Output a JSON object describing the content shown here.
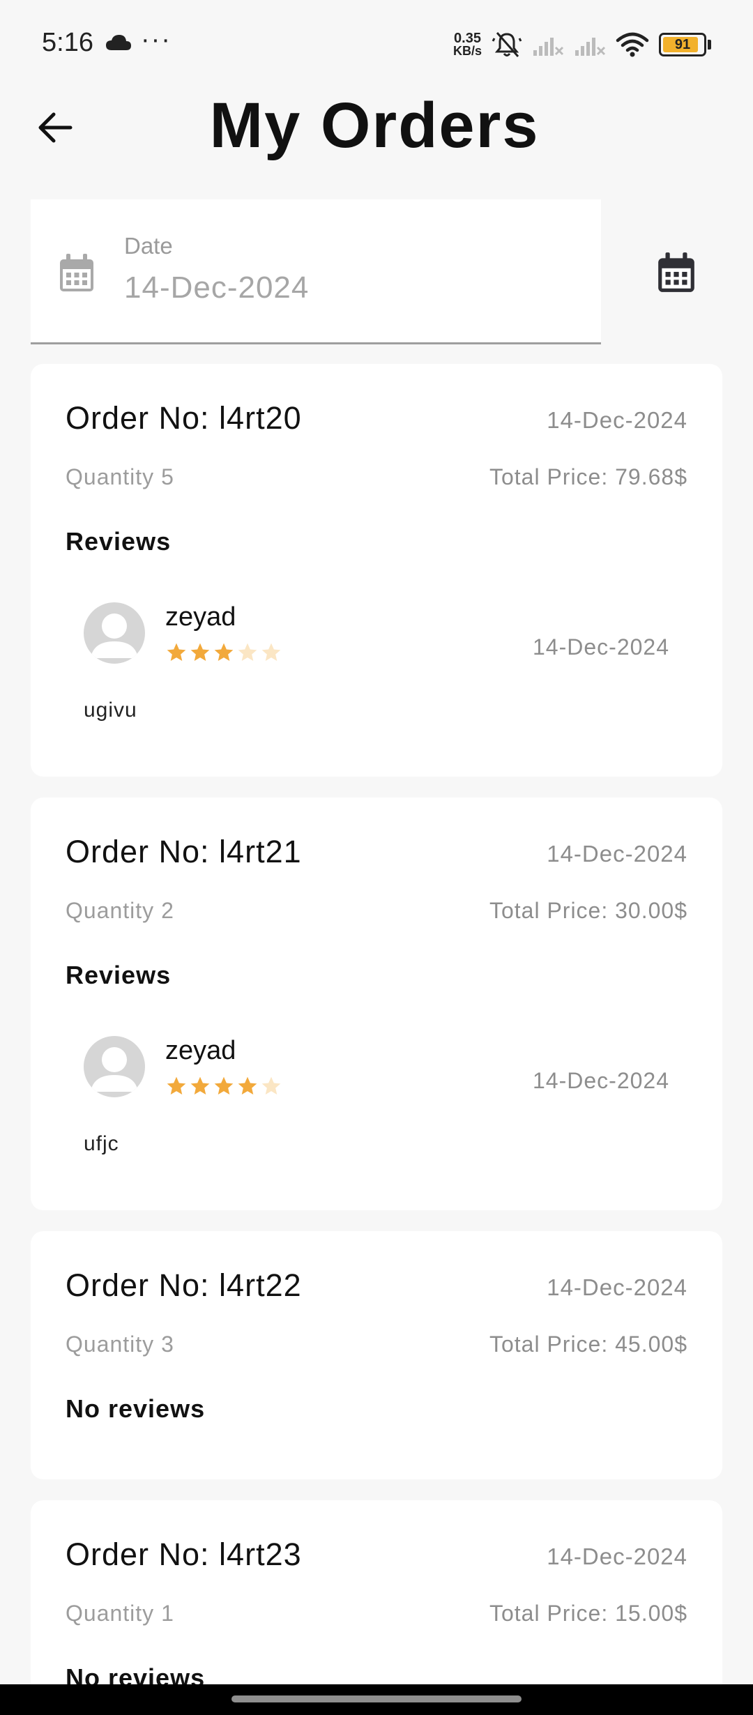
{
  "status_bar": {
    "time": "5:16",
    "dots": "···",
    "net_speed_value": "0.35",
    "net_speed_unit": "KB/s",
    "battery_level": 91,
    "battery_color": "#f2b12c"
  },
  "header": {
    "title": "My Orders"
  },
  "date_filter": {
    "label": "Date",
    "value": "14-Dec-2024"
  },
  "orders": [
    {
      "order_no": "Order No: l4rt20",
      "date": "14-Dec-2024",
      "quantity": "Quantity 5",
      "total_price": "Total Price: 79.68$",
      "reviews_heading": "Reviews",
      "review": {
        "name": "zeyad",
        "rating": 3,
        "date": "14-Dec-2024",
        "text": "ugivu"
      }
    },
    {
      "order_no": "Order No: l4rt21",
      "date": "14-Dec-2024",
      "quantity": "Quantity 2",
      "total_price": "Total Price: 30.00$",
      "reviews_heading": "Reviews",
      "review": {
        "name": "zeyad",
        "rating": 4,
        "date": "14-Dec-2024",
        "text": "ufjc"
      }
    },
    {
      "order_no": "Order No: l4rt22",
      "date": "14-Dec-2024",
      "quantity": "Quantity 3",
      "total_price": "Total Price: 45.00$",
      "reviews_heading": "No reviews"
    },
    {
      "order_no": "Order No: l4rt23",
      "date": "14-Dec-2024",
      "quantity": "Quantity 1",
      "total_price": "Total Price: 15.00$",
      "reviews_heading": "No reviews"
    }
  ],
  "colors": {
    "star_filled": "#f2a93b",
    "star_empty": "#fbe6c4"
  }
}
